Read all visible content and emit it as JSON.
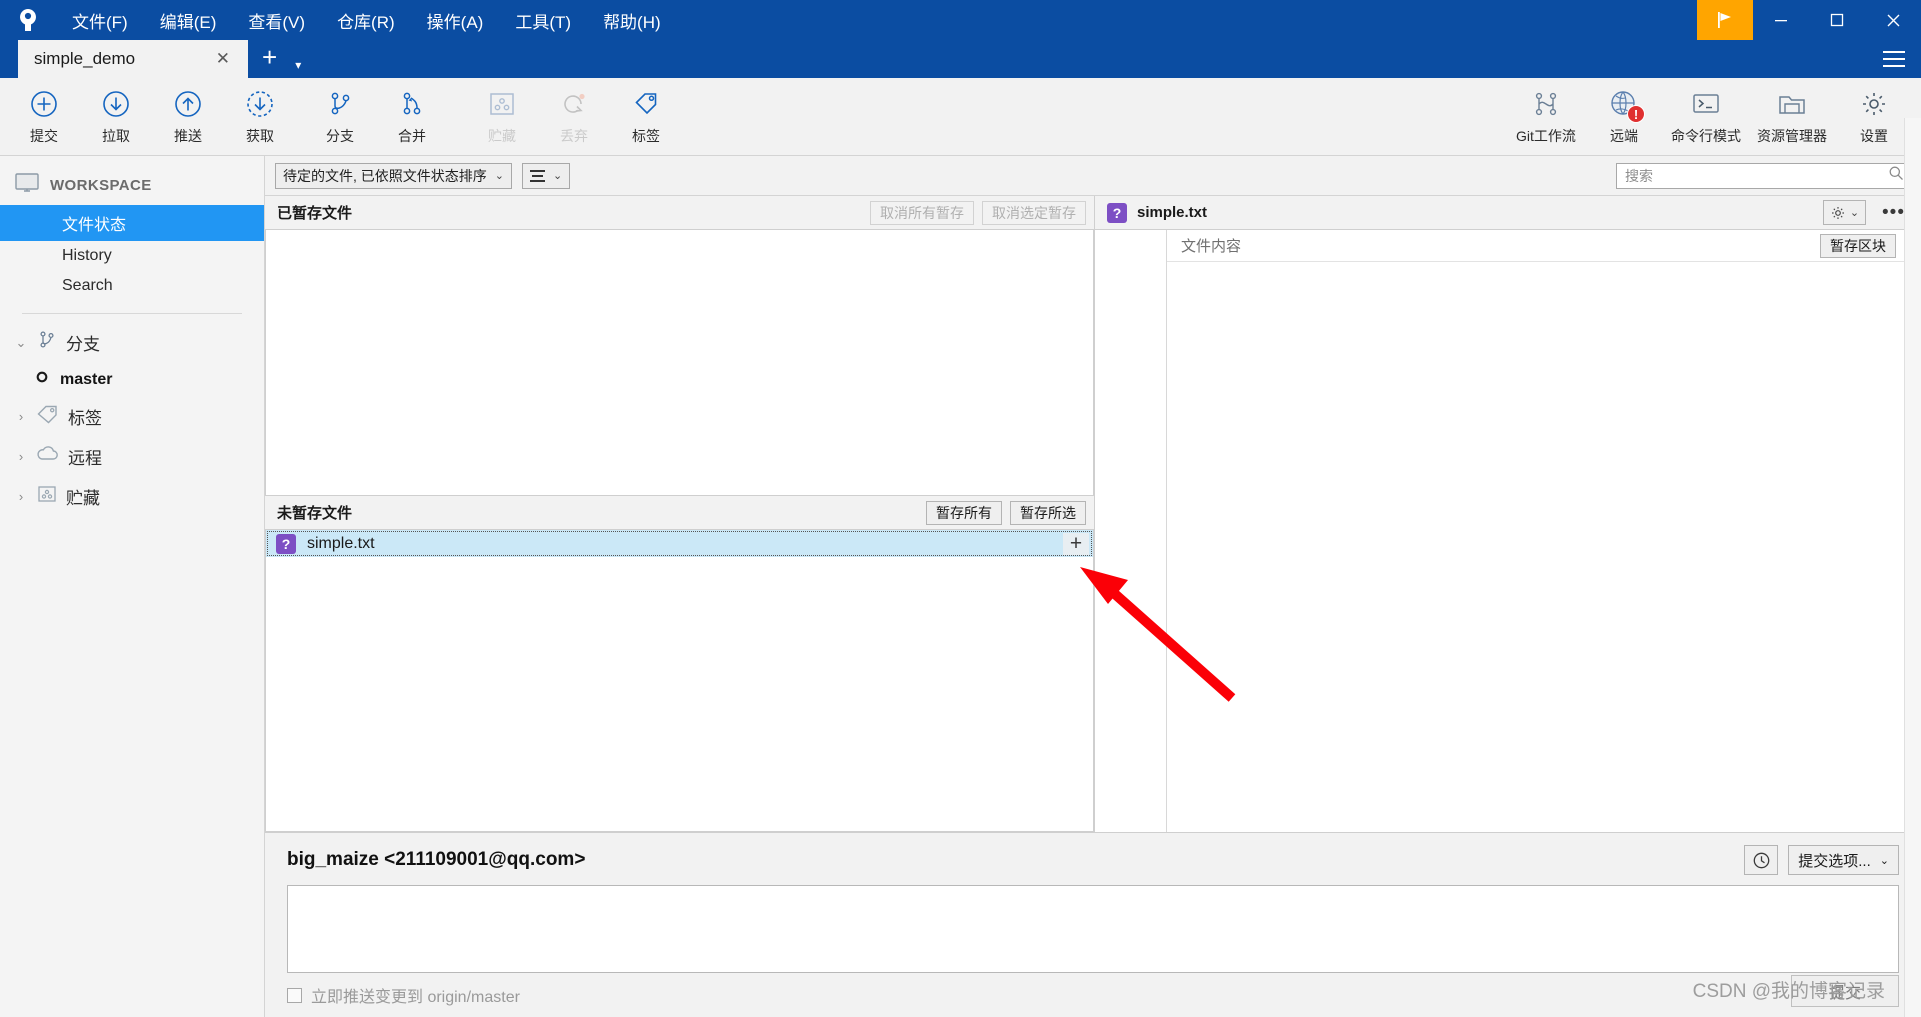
{
  "window": {
    "menus": [
      {
        "label": "文件(F)",
        "accel": "F"
      },
      {
        "label": "编辑(E)",
        "accel": "E"
      },
      {
        "label": "查看(V)",
        "accel": "V"
      },
      {
        "label": "仓库(R)",
        "accel": "R"
      },
      {
        "label": "操作(A)",
        "accel": "A"
      },
      {
        "label": "工具(T)",
        "accel": "T"
      },
      {
        "label": "帮助(H)",
        "accel": "H"
      }
    ],
    "controls": {
      "flag": "flag-icon",
      "minimize": "—",
      "maximize": "□",
      "close": "✕",
      "app_menu": "hamburger-icon"
    }
  },
  "tabs": {
    "items": [
      {
        "label": "simple_demo",
        "active": true
      }
    ],
    "close_glyph": "✕",
    "add_glyph": "+",
    "dropdown_glyph": "▾"
  },
  "toolbar": {
    "left": [
      {
        "label": "提交",
        "icon": "commit-icon",
        "disabled": false
      },
      {
        "label": "拉取",
        "icon": "pull-icon",
        "disabled": false
      },
      {
        "label": "推送",
        "icon": "push-icon",
        "disabled": false
      },
      {
        "label": "获取",
        "icon": "fetch-icon",
        "disabled": false
      },
      {
        "label": "分支",
        "icon": "branch-icon",
        "disabled": false
      },
      {
        "label": "合并",
        "icon": "merge-icon",
        "disabled": false
      },
      {
        "label": "贮藏",
        "icon": "stash-icon",
        "disabled": true
      },
      {
        "label": "丢弃",
        "icon": "discard-icon",
        "disabled": true
      },
      {
        "label": "标签",
        "icon": "tag-icon",
        "disabled": false
      }
    ],
    "right": [
      {
        "label": "Git工作流",
        "icon": "gitflow-icon",
        "badge": ""
      },
      {
        "label": "远端",
        "icon": "remote-globe-icon",
        "badge": "!"
      },
      {
        "label": "命令行模式",
        "icon": "terminal-icon",
        "badge": ""
      },
      {
        "label": "资源管理器",
        "icon": "explorer-icon",
        "badge": ""
      },
      {
        "label": "设置",
        "icon": "gear-icon",
        "badge": ""
      }
    ]
  },
  "sidebar": {
    "workspace": {
      "label": "WORKSPACE",
      "icon": "monitor-icon"
    },
    "items": [
      {
        "label": "文件状态",
        "selected": true
      },
      {
        "label": "History",
        "selected": false
      },
      {
        "label": "Search",
        "selected": false
      }
    ],
    "tree": [
      {
        "label": "分支",
        "icon": "branch-icon",
        "expanded": true,
        "arrow": "⌄"
      },
      {
        "label": "标签",
        "icon": "tag-icon",
        "expanded": false,
        "arrow": "›"
      },
      {
        "label": "远程",
        "icon": "cloud-icon",
        "expanded": false,
        "arrow": "›"
      },
      {
        "label": "贮藏",
        "icon": "stash-icon",
        "expanded": false,
        "arrow": "›"
      }
    ],
    "branches": [
      {
        "label": "master",
        "current": true,
        "icon": "branch-dot-icon"
      }
    ]
  },
  "filterbar": {
    "sort_combo": "待定的文件, 已依照文件状态排序",
    "sort_caret": "⌄",
    "view_caret": "⌄",
    "view_icon": "list-view-icon"
  },
  "search": {
    "placeholder": "搜索",
    "value": "",
    "icon": "search-icon"
  },
  "staged": {
    "title": "已暂存文件",
    "unstage_all": "取消所有暂存",
    "unstage_selected": "取消选定暂存",
    "files": []
  },
  "unstaged": {
    "title": "未暂存文件",
    "stage_all": "暂存所有",
    "stage_selected": "暂存所选",
    "files": [
      {
        "name": "simple.txt",
        "status": "?",
        "status_name": "untracked",
        "selected": true,
        "stage_glyph": "+"
      }
    ]
  },
  "diff": {
    "file_name": "simple.txt",
    "file_status": "?",
    "gear_icon": "gear-icon",
    "gear_caret": "⌄",
    "more_icon": "more-dots-icon",
    "hunk_label": "文件内容",
    "stage_hunk_button": "暂存区块",
    "scroll_up": "▲",
    "scroll_down": "▼"
  },
  "commit": {
    "author": "big_maize <211109001@qq.com>",
    "history_icon": "clock-icon",
    "options_label": "提交选项...",
    "options_caret": "⌄",
    "message_value": "",
    "message_placeholder": "",
    "push_checkbox_label": "立即推送变更到 origin/master",
    "push_checked": false,
    "commit_button": "提交"
  },
  "watermark": "CSDN @我的博客记录",
  "colors": {
    "titlebar": "#0b4da2",
    "accent_selected": "#2196f3",
    "flag_button": "#ffa500",
    "untracked_badge": "#7d4fc4",
    "row_selected": "#cbe8f7",
    "annotation_arrow": "#fb0007",
    "badge_red": "#e03030"
  }
}
